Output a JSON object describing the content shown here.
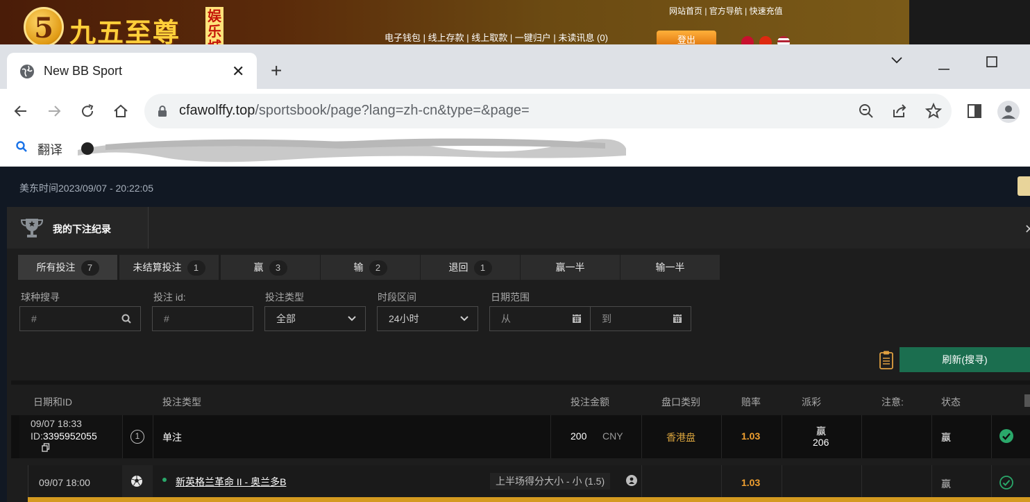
{
  "site": {
    "logo_digit": "5",
    "logo_text": "九五至尊",
    "logo_badge": "娱乐城",
    "top_links": "网站首页 | 官方导航 | 快速充值",
    "nav_links": "电子钱包 | 线上存款 | 线上取款 | 一键归户 | 未读讯息 (0)",
    "login_button": "登出"
  },
  "browser": {
    "tab_title": "New BB Sport",
    "url_host": "cfawolffy.top",
    "url_path": "/sportsbook/page?lang=zh-cn&type=&page=",
    "bookmark_label": "翻译"
  },
  "page": {
    "time_text": "美东时间2023/09/07 - 20:22:05",
    "modal_title": "我的下注纪录",
    "filter_tabs": [
      {
        "label": "所有投注",
        "count": "7"
      },
      {
        "label": "未结算投注",
        "count": "1"
      },
      {
        "label": "赢",
        "count": "3"
      },
      {
        "label": "输",
        "count": "2"
      },
      {
        "label": "退回",
        "count": "1"
      },
      {
        "label": "赢一半",
        "count": ""
      },
      {
        "label": "输一半",
        "count": ""
      }
    ],
    "filters": {
      "sport_label": "球种搜寻",
      "sport_placeholder": "#",
      "betid_label": "投注 id:",
      "betid_placeholder": "#",
      "bettype_label": "投注类型",
      "bettype_value": "全部",
      "period_label": "时段区间",
      "period_value": "24小时",
      "date_label": "日期范围",
      "date_from": "从",
      "date_to": "到"
    },
    "refresh_button": "刷新(搜寻)",
    "columns": [
      "日期和ID",
      "投注类型",
      "投注金额",
      "盘口类别",
      "赔率",
      "派彩",
      "注意:",
      "状态"
    ],
    "bet": {
      "datetime": "09/07 18:33",
      "id_prefix": "ID:",
      "id": "3395952055",
      "leg_count": "1",
      "type": "单注",
      "amount": "200",
      "currency": "CNY",
      "market": "香港盘",
      "odds": "1.03",
      "payout_label": "赢",
      "payout_value": "206",
      "status": "赢"
    },
    "leg": {
      "time": "09/07 18:00",
      "match": "新英格兰革命 II - 奥兰多B",
      "selection": "上半场得分大小 - 小 (1.5)",
      "odds": "1.03",
      "status": "赢"
    }
  },
  "colors": {
    "accent_green": "#1b6e4f",
    "odds_orange": "#f0a030",
    "market_gold": "#d4a03c"
  }
}
